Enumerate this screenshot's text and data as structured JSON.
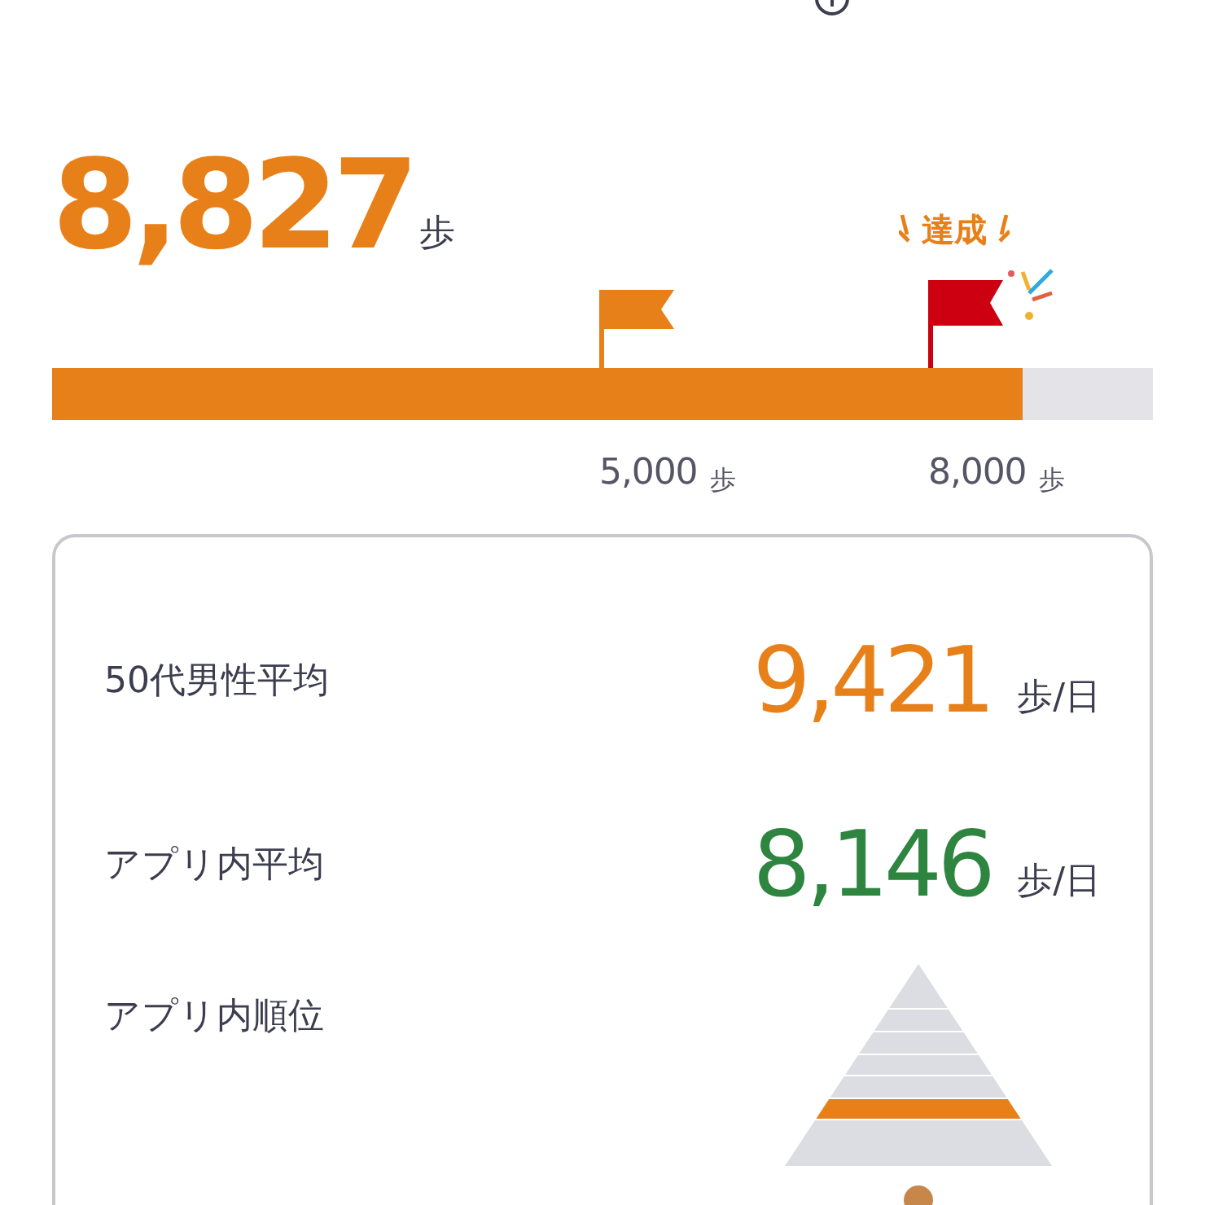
{
  "steps": {
    "value": "8,827",
    "unit": "歩",
    "level": 0.882
  },
  "milestones": [
    {
      "label": "5,000",
      "unit": "歩",
      "achieved": false
    },
    {
      "label": "8,000",
      "unit": "歩",
      "achieved": true,
      "badge": "達成"
    }
  ],
  "stats": [
    {
      "label": "50代男性平均",
      "value": "9,421",
      "unit": "歩/日",
      "color": "#e8801a"
    },
    {
      "label": "アプリ内平均",
      "value": "8,146",
      "unit": "歩/日",
      "color": "#2e8540"
    }
  ],
  "rank": {
    "label": "アプリ内順位",
    "tiers": [
      {
        "selected": false
      },
      {
        "selected": false
      },
      {
        "selected": false
      },
      {
        "selected": false
      },
      {
        "selected": false
      },
      {
        "selected": true
      },
      {
        "selected": false
      }
    ]
  }
}
